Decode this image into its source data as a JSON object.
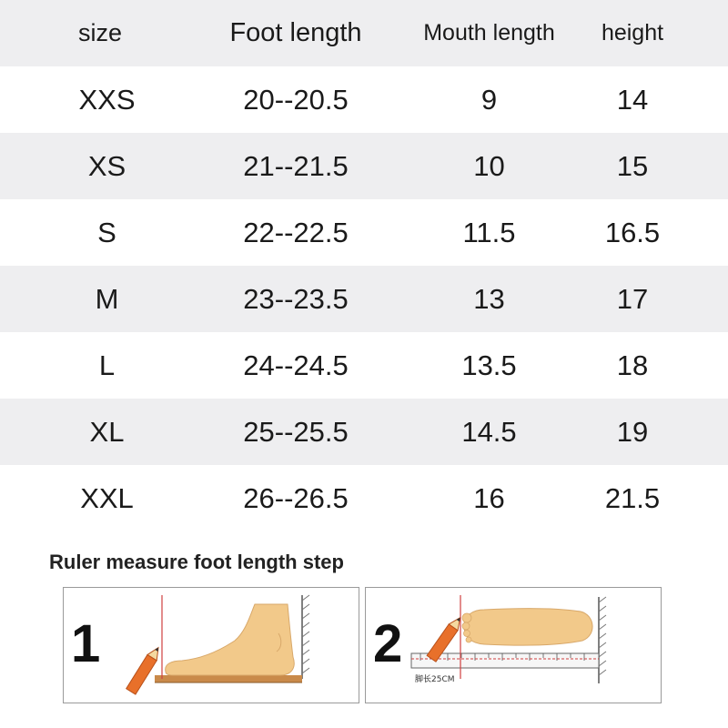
{
  "table": {
    "headers": {
      "size": "size",
      "foot_length": "Foot length",
      "mouth_length": "Mouth length",
      "height": "height"
    },
    "rows": [
      {
        "size": "XXS",
        "foot_length": "20--20.5",
        "mouth_length": "9",
        "height": "14"
      },
      {
        "size": "XS",
        "foot_length": "21--21.5",
        "mouth_length": "10",
        "height": "15"
      },
      {
        "size": "S",
        "foot_length": "22--22.5",
        "mouth_length": "11.5",
        "height": "16.5"
      },
      {
        "size": "M",
        "foot_length": "23--23.5",
        "mouth_length": "13",
        "height": "17"
      },
      {
        "size": "L",
        "foot_length": "24--24.5",
        "mouth_length": "13.5",
        "height": "18"
      },
      {
        "size": "XL",
        "foot_length": "25--25.5",
        "mouth_length": "14.5",
        "height": "19"
      },
      {
        "size": "XXL",
        "foot_length": "26--26.5",
        "mouth_length": "16",
        "height": "21.5"
      }
    ]
  },
  "caption": "Ruler measure foot length step",
  "steps": [
    {
      "number": "1",
      "icon": "foot-side-with-pencil-icon"
    },
    {
      "number": "2",
      "icon": "foot-top-on-ruler-icon",
      "ruler_label": "脚长25CM"
    }
  ],
  "colors": {
    "row_shade": "#eeeef0",
    "foot": "#f2c98a",
    "pencil": "#e8702a",
    "guide_line": "#d04040"
  }
}
